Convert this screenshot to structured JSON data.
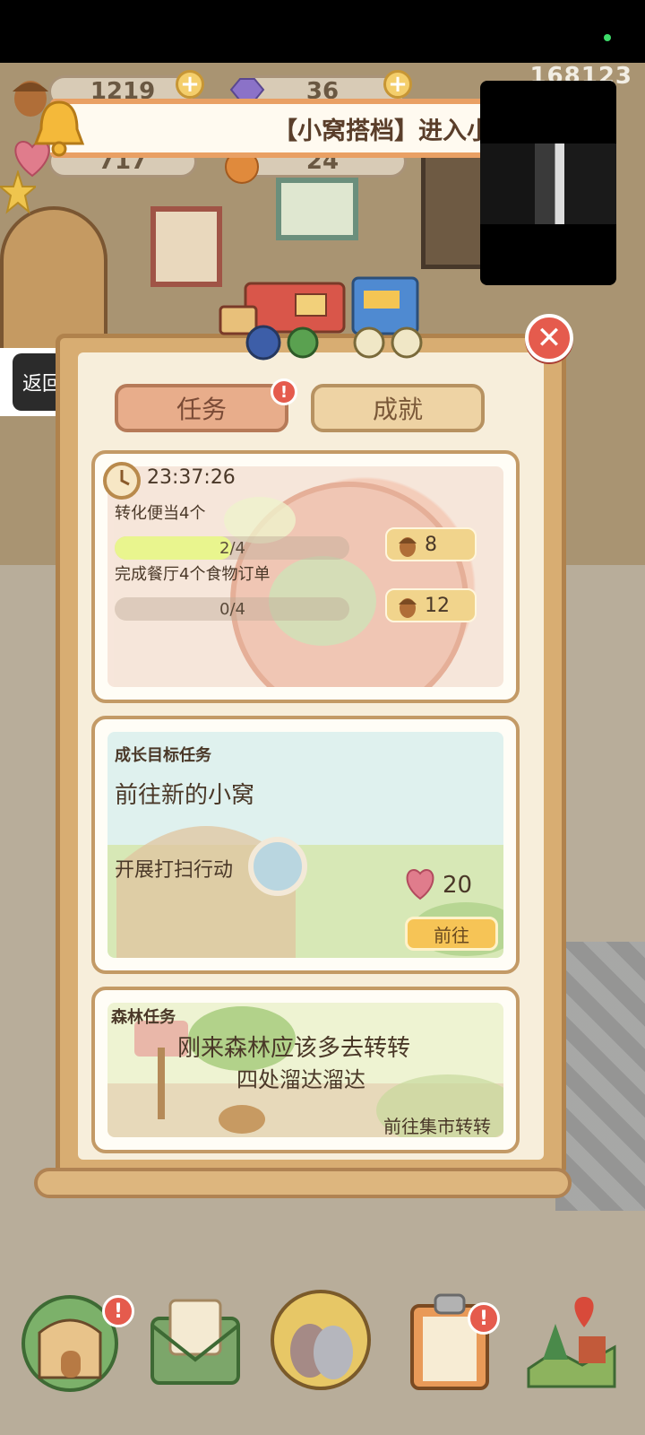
{
  "status_bar": {},
  "header": {
    "acorns": "1219",
    "gems": "36",
    "hearts": "717",
    "coins": "24",
    "counter": "168123",
    "notification": "【小窝搭档】进入小"
  },
  "back_button": {
    "label": "返回"
  },
  "tabs": [
    {
      "label": "任务",
      "badge": "!"
    },
    {
      "label": "成就"
    }
  ],
  "daily": {
    "timer": "23:37:26",
    "tasks": [
      {
        "desc": "转化便当4个",
        "progress_text": "2/4",
        "progress": 0.5,
        "reward": "8"
      },
      {
        "desc": "完成餐厅4个食物订单",
        "progress_text": "0/4",
        "progress": 0,
        "reward": "12"
      }
    ]
  },
  "growth": {
    "category": "成长目标任务",
    "title": "前往新的小窝",
    "desc": "开展打扫行动",
    "reward": "20",
    "button": "前往"
  },
  "forest": {
    "category": "森林任务",
    "line1": "刚来森林应该多去转转",
    "line2": "四处溜达溜达",
    "link": "前往集市转转"
  },
  "bottom_nav": {
    "badges": [
      "!",
      "!"
    ]
  },
  "colors": {
    "accent_red": "#e55b4d",
    "panel_wood": "#d8ad72",
    "button_yellow": "#f6c456",
    "progress_green": "#e9f58e"
  }
}
